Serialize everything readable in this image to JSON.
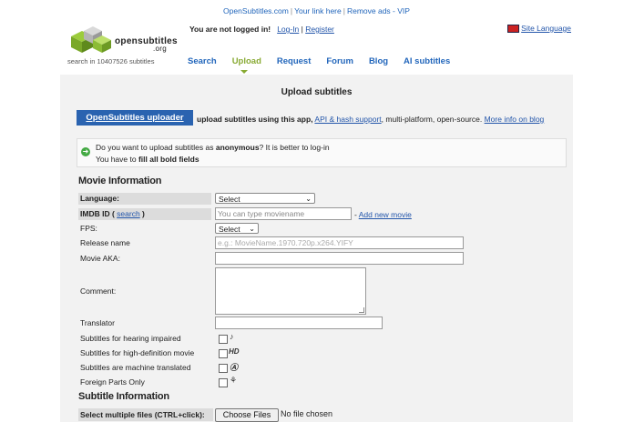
{
  "topbar": {
    "site": "OpenSubtitles.com",
    "link": "Your link here",
    "ads": "Remove ads - VIP"
  },
  "header": {
    "logo_text": "opensubtitles",
    "logo_org": ".org",
    "search_count": "search in 10407526 subtitles",
    "not_logged": "You are not logged in!",
    "login": "Log-In",
    "register": "Register",
    "site_language": "Site Language",
    "nav": [
      "Search",
      "Upload",
      "Request",
      "Forum",
      "Blog",
      "AI subtitles"
    ]
  },
  "main": {
    "title": "Upload subtitles",
    "uploader_button": "OpenSubtitles uploader",
    "uploader_text": "upload subtitles using this app,",
    "api_link": "API & hash support",
    "uploader_text2": ", multi-platform, open-source.",
    "more_info": "More info on blog",
    "notice_line1a": "Do you want to upload subtitles as ",
    "notice_line1b": "anonymous",
    "notice_line1c": "? It is better to log-in",
    "notice_line2a": "You have to ",
    "notice_line2b": "fill all bold fields"
  },
  "movie": {
    "heading": "Movie Information",
    "language_label": "Language:",
    "language_value": "Select",
    "imdb_label": "IMDB ID (",
    "imdb_search": "search",
    "imdb_close": ")",
    "imdb_placeholder": "You can type moviename",
    "add_new_movie": "Add new movie",
    "fps_label": "FPS:",
    "fps_value": "Select",
    "release_label": "Release name",
    "release_placeholder": "e.g.: MovieName.1970.720p.x264.YIFY",
    "aka_label": "Movie AKA:",
    "comment_label": "Comment:",
    "translator_label": "Translator",
    "hearing_label": "Subtitles for hearing impaired",
    "hd_label": "Subtitles for high-definition movie",
    "machine_label": "Subtitles are machine translated",
    "foreign_label": "Foreign Parts Only"
  },
  "subtitle": {
    "heading": "Subtitle Information",
    "files_label": "Select multiple files (CTRL+click):",
    "choose_files": "Choose Files",
    "no_file": "No file chosen"
  }
}
